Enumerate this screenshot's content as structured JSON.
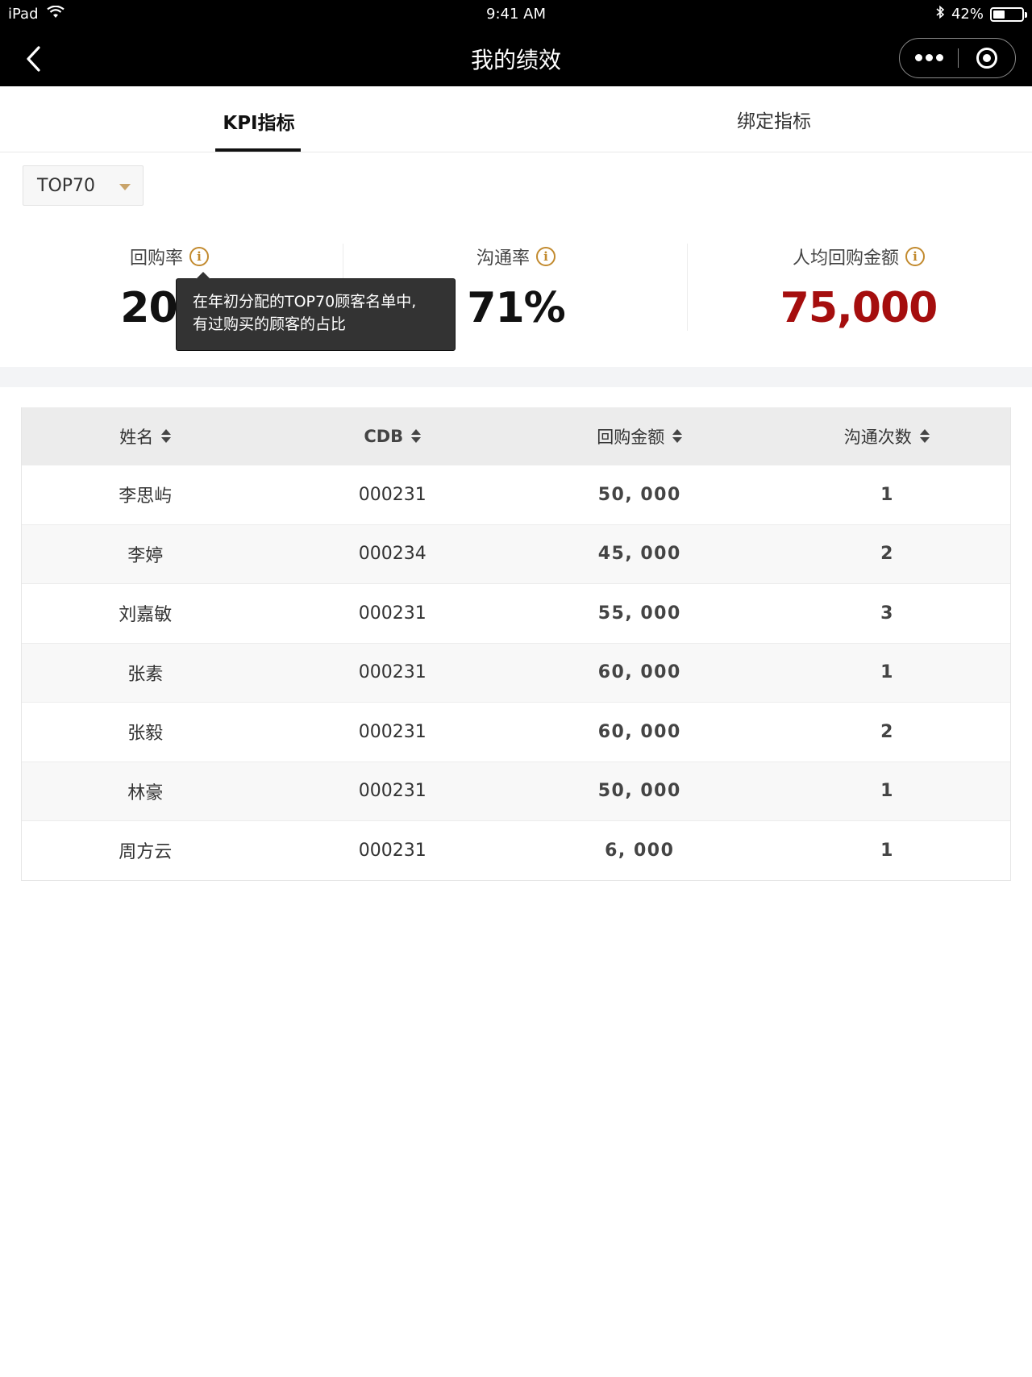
{
  "status_bar": {
    "device": "iPad",
    "time": "9:41 AM",
    "battery": "42%",
    "battery_level": 0.42
  },
  "nav": {
    "title": "我的绩效"
  },
  "tabs": [
    {
      "label": "KPI指标",
      "active": true
    },
    {
      "label": "绑定指标",
      "active": false
    }
  ],
  "filter": {
    "selected": "TOP70"
  },
  "metrics": [
    {
      "label": "回购率",
      "value": "20%"
    },
    {
      "label": "沟通率",
      "value": "71%"
    },
    {
      "label": "人均回购金额",
      "value": "75,000",
      "color": "#a50e0e"
    }
  ],
  "tooltip": {
    "line1": "在年初分配的TOP70顾客名单中,",
    "line2": "有过购买的顾客的占比"
  },
  "table": {
    "headers": [
      "姓名",
      "CDB",
      "回购金额",
      "沟通次数"
    ],
    "rows": [
      {
        "name": "李思屿",
        "cdb": "000231",
        "amount": "50, 000",
        "count": "1"
      },
      {
        "name": "李婷",
        "cdb": "000234",
        "amount": "45, 000",
        "count": "2"
      },
      {
        "name": "刘嘉敏",
        "cdb": "000231",
        "amount": "55, 000",
        "count": "3"
      },
      {
        "name": "张素",
        "cdb": "000231",
        "amount": "60, 000",
        "count": "1"
      },
      {
        "name": "张毅",
        "cdb": "000231",
        "amount": "60, 000",
        "count": "2"
      },
      {
        "name": "林豪",
        "cdb": "000231",
        "amount": "50, 000",
        "count": "1"
      },
      {
        "name": "周方云",
        "cdb": "000231",
        "amount": "6, 000",
        "count": "1"
      }
    ]
  }
}
